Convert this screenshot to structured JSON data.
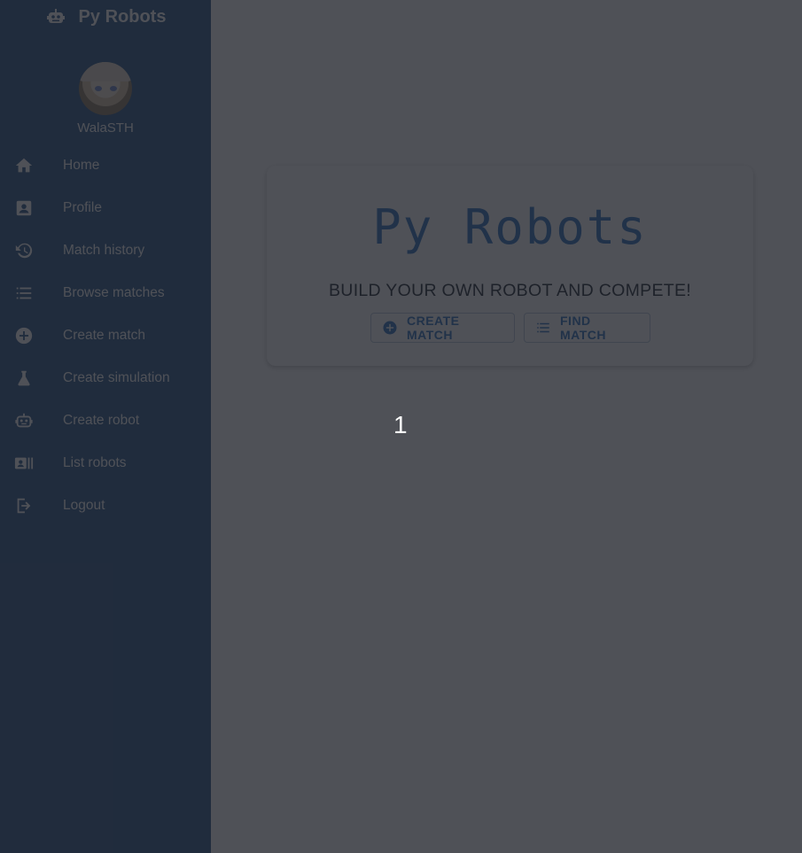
{
  "app": {
    "brand": "Py Robots"
  },
  "user": {
    "name": "WalaSTH"
  },
  "sidebar": {
    "items": [
      {
        "label": "Home",
        "icon": "home-icon"
      },
      {
        "label": "Profile",
        "icon": "profile-icon"
      },
      {
        "label": "Match history",
        "icon": "history-icon"
      },
      {
        "label": "Browse matches",
        "icon": "list-icon"
      },
      {
        "label": "Create match",
        "icon": "add-circle-icon"
      },
      {
        "label": "Create simulation",
        "icon": "flask-icon"
      },
      {
        "label": "Create robot",
        "icon": "robot-icon"
      },
      {
        "label": "List robots",
        "icon": "badge-list-icon"
      },
      {
        "label": "Logout",
        "icon": "logout-icon"
      }
    ]
  },
  "hero": {
    "title": "Py Robots",
    "subtitle": "BUILD YOUR OWN ROBOT AND COMPETE!",
    "create_label": "CREATE MATCH",
    "find_label": "FIND MATCH"
  },
  "overlay": {
    "page_number": "1"
  },
  "colors": {
    "sidebar": "#2a5788",
    "accent": "#2f73c0",
    "overlay": "#1e2028"
  }
}
